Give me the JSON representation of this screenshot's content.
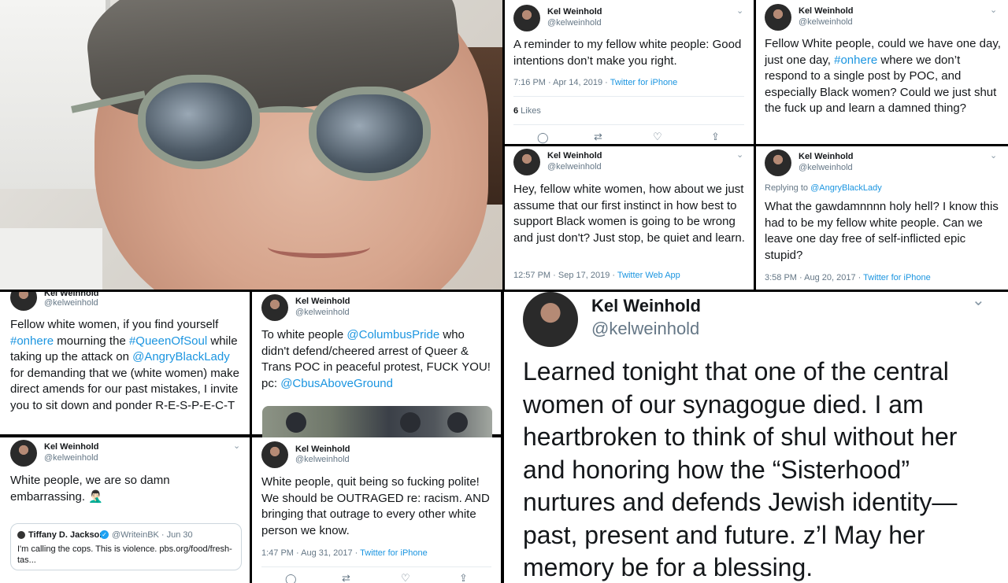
{
  "user": {
    "name": "Kel Weinhold",
    "handle": "@kelweinhold"
  },
  "tweets": {
    "t1": {
      "text": "A reminder to my fellow white people: Good intentions don’t make you right.",
      "time": "7:16 PM · Apr 14, 2019 · ",
      "source": "Twitter for iPhone",
      "likes_count": "6",
      "likes_label": " Likes"
    },
    "t2": {
      "text_a": "Fellow White people, could we have one day, just one day, ",
      "hashtag": "#onhere",
      "text_b": " where we don’t respond to a single post by POC, and especially Black women? Could we just shut the fuck up and learn a damned thing?"
    },
    "t3": {
      "text": "Hey, fellow white women, how about we just assume that our first instinct in how best to support Black women is going to be wrong and just don't? Just stop, be quiet and learn.",
      "time": "12:57 PM · Sep 17, 2019 · ",
      "source": "Twitter Web App"
    },
    "t4": {
      "replying_label": "Replying to ",
      "replying_to": "@AngryBlackLady",
      "text": "What the gawdamnnnn holy hell? I know this had to be my fellow white people. Can we leave one day free of self-inflicted epic stupid?",
      "time": "3:58 PM · Aug 20, 2017 · ",
      "source": "Twitter for iPhone"
    },
    "t5": {
      "text_a": "Fellow white women, if you find yourself ",
      "tag1": "#onhere",
      "text_b": " mourning the ",
      "tag2": "#QueenOfSoul",
      "text_c": " while taking up the attack on ",
      "tag3": "@AngryBlackLady",
      "text_d": " for demanding that we (white women) make direct amends for our past mistakes, I invite you to sit down and ponder R-E-S-P-E-C-T"
    },
    "t6": {
      "text_a": "To white people ",
      "tag1": "@ColumbusPride",
      "text_b": " who didn't defend/cheered arrest of Queer & Trans POC in peaceful protest, FUCK YOU! pc: ",
      "tag2": "@CbusAboveGround"
    },
    "t7": {
      "text": "White people, we are so damn embarrassing. 🤦🏻‍♂️",
      "quote": {
        "name": "Tiffany D. Jackson",
        "handle": "@WriteinBK · Jun 30",
        "text": "I'm calling the cops. This is violence. pbs.org/food/fresh-tas..."
      }
    },
    "t8": {
      "text": "White people, quit being so fucking polite! We should be OUTRAGED re: racism. AND bringing that outrage to every other white person we know.",
      "time": "1:47 PM · Aug 31, 2017 · ",
      "source": "Twitter for iPhone"
    },
    "big": {
      "text": "Learned tonight that one of the central women of our synagogue died. I am heartbroken to think of shul without her and honoring how the “Sisterhood” nurtures and defends Jewish identity—past, present and future. z’l May her memory be for a blessing."
    }
  },
  "icons": [
    "reply-icon",
    "retweet-icon",
    "like-icon",
    "share-icon",
    "chevron-down-icon",
    "verified-icon"
  ]
}
